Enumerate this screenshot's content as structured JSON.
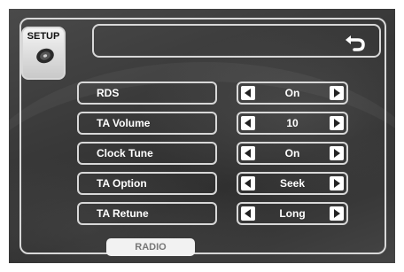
{
  "setup_tab": {
    "label": "SETUP",
    "icon": "disc-icon"
  },
  "header": {
    "back_icon": "back-arrow-icon"
  },
  "settings": [
    {
      "label": "RDS",
      "value": "On"
    },
    {
      "label": "TA Volume",
      "value": "10"
    },
    {
      "label": "Clock Tune",
      "value": "On"
    },
    {
      "label": "TA Option",
      "value": "Seek"
    },
    {
      "label": "TA Retune",
      "value": "Long"
    }
  ],
  "footer": {
    "radio_tab_label": "RADIO"
  },
  "colors": {
    "background": "#3a3a3a",
    "border": "#d8d8d8",
    "text": "#ffffff"
  }
}
